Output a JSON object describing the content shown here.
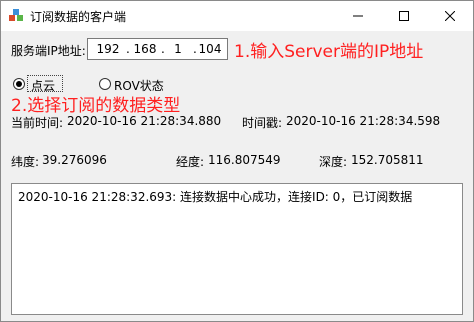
{
  "window": {
    "title": "订阅数据的客户端",
    "buttons": {
      "minimize": "minimize",
      "maximize": "maximize",
      "close": "close"
    }
  },
  "server": {
    "label": "服务端IP地址:",
    "ip": [
      "192",
      "168",
      "1",
      "104"
    ],
    "separator": "."
  },
  "annotations": {
    "step1": "1.输入Server端的IP地址",
    "step2": "2.选择订阅的数据类型"
  },
  "data_type": {
    "options": [
      {
        "label": "点云",
        "selected": true
      },
      {
        "label": "ROV状态",
        "selected": false
      }
    ]
  },
  "times": {
    "current_label": "当前时间:",
    "current_value": "2020-10-16 21:28:34.880",
    "stamp_label": "时间戳:",
    "stamp_value": "2020-10-16 21:28:34.598"
  },
  "position": {
    "lat_label": "纬度:",
    "lat_value": "39.276096",
    "lon_label": "经度:",
    "lon_value": "116.807549",
    "depth_label": "深度:",
    "depth_value": "152.705811"
  },
  "log": {
    "lines": [
      "2020-10-16 21:28:32.693: 连接数据中心成功，连接ID: 0，已订阅数据"
    ]
  },
  "colors": {
    "annotation": "#ff2020",
    "background": "#f0f0f0"
  }
}
